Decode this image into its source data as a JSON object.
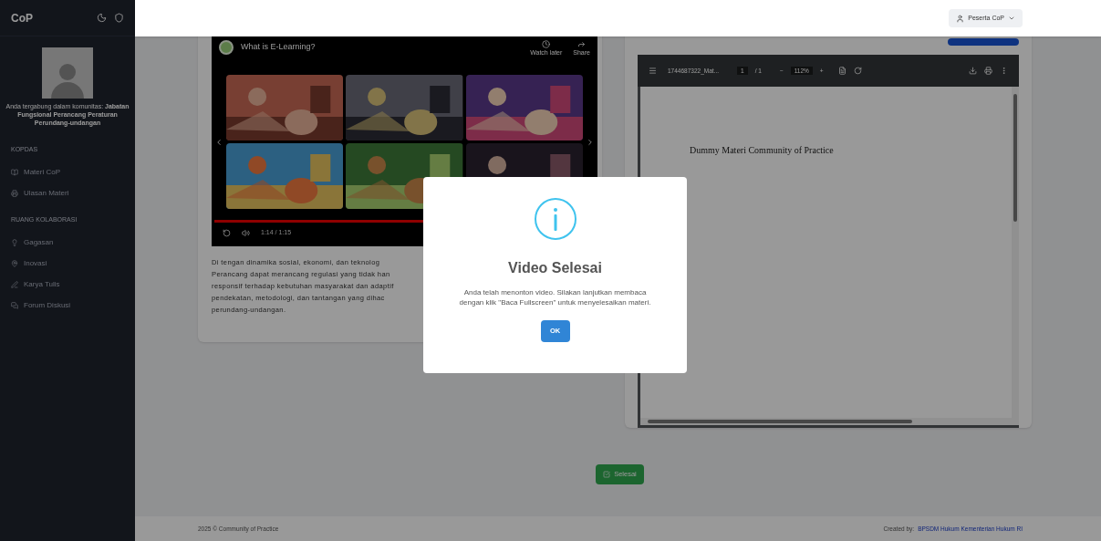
{
  "sidebar": {
    "brand": "CoP",
    "membership": "Anda tergabung dalam komunitas: **Jabatan Fungsional Perancang Peraturan Perundang-undangan**",
    "sections": [
      {
        "heading": "KOPDAS",
        "items": [
          {
            "label": "Materi CoP"
          },
          {
            "label": "Ulasan Materi"
          }
        ]
      },
      {
        "heading": "RUANG KOLABORASI",
        "items": [
          {
            "label": "Gagasan"
          },
          {
            "label": "Inovasi"
          },
          {
            "label": "Karya Tulis"
          },
          {
            "label": "Forum Diskusi"
          }
        ]
      }
    ]
  },
  "header": {
    "user": "Peserta CoP"
  },
  "video": {
    "title": "What is E-Learning?",
    "watch_later": "Watch later",
    "share": "Share",
    "time": "1:14 / 1:15",
    "level": 0.985,
    "thumbnails": [
      {
        "kind": "picture"
      },
      {
        "kind": "picture"
      },
      {
        "kind": "picture"
      },
      {
        "kind": "picture"
      },
      {
        "kind": "picture"
      },
      {
        "kind": "picture"
      }
    ]
  },
  "paragraph_lines": [
    "Di tengan dinamika sosial, ekonomi, dan teknolog",
    "Perancang dapat merancang regulasi yang tidak han",
    "responsif terhadap kebutuhan masyarakat dan adaptif",
    "pendekatan, metodologi, dan tantangan yang dihac",
    "perundang-undangan."
  ],
  "pdf": {
    "filename": "1744687322_Mat...",
    "page": "1",
    "page_total": "/ 1",
    "zoom_out": "−",
    "zoom": "112%",
    "zoom_in": "+",
    "page_text": "Dummy Materi Community of Practice"
  },
  "finish_button": "Selesai",
  "footer": {
    "copyright": "2025 © Community of Practice",
    "credit_prefix": "Created by:",
    "credit_link": "BPSDM Hukum Kementerian Hukum RI"
  },
  "modal": {
    "title": "Video Selesai",
    "message": "Anda telah menonton video. Silakan lanjutkan membaca dengan klik \"Baca Fullscreen\" untuk menyelesaikan materi.",
    "ok": "OK"
  }
}
